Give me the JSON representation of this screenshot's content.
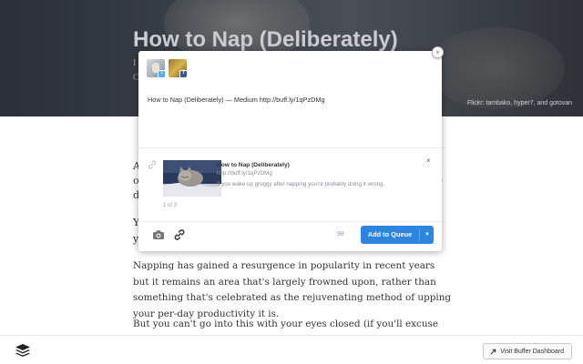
{
  "article": {
    "hero_title": "How to Nap (Deliberately)",
    "hero_meta_1": "I",
    "hero_meta_2": "C",
    "photo_credit": "Flickr: tambako, hyper7, and gotovan",
    "para1_stub": "A",
    "para1_line2_left": "o",
    "para1_line2_right": ",",
    "para1_line3_left": "d",
    "para2_stub": "Y",
    "para2_line2": "y",
    "para3": "Napping has gained a resurgence in popularity in recent years but it remains an area that's largely frowned upon, rather than something that's celebrated as the rejuvenating method of upping your per-day productivity it is.",
    "para4": "But you can't go into this with your eyes closed (if you'll excuse the pun)."
  },
  "composer": {
    "close_glyph": "×",
    "profiles": [
      {
        "network": "twitter",
        "badge": "t"
      },
      {
        "network": "facebook",
        "badge": "f"
      }
    ],
    "text": "How to Nap (Deliberately) — Medium http://buff.ly/1qPzDMg",
    "preview": {
      "title": "How to Nap (Deliberately)",
      "url": "http://buff.ly/1qPzDMg",
      "description": "If you wake up groggy after napping you're probably doing it wrong.",
      "counter": "1 of 3",
      "close_glyph": "×"
    },
    "char_count": "98",
    "primary_button": "Add to Queue",
    "accent_color": "#2b85e3"
  },
  "bottombar": {
    "dashboard_button": "Visit Buffer Dashboard"
  }
}
